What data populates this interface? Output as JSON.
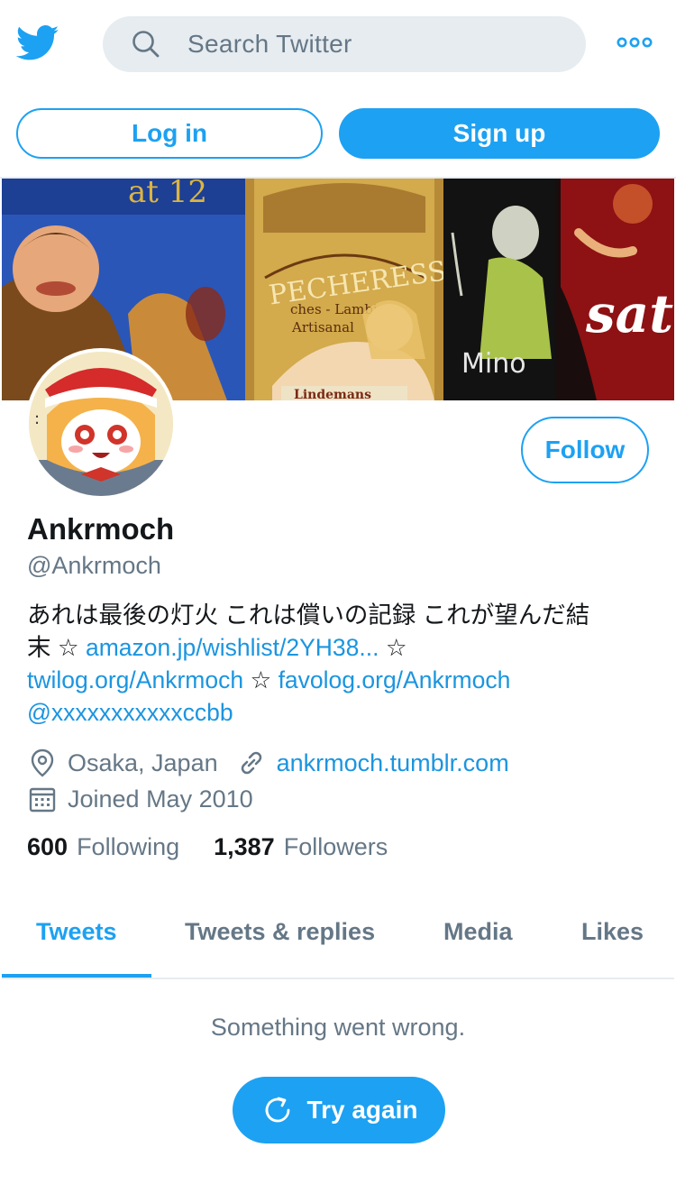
{
  "header": {
    "logo_icon": "twitter-bird-icon",
    "search_placeholder": "Search Twitter",
    "more_icon": "more-dots-icon"
  },
  "auth": {
    "login_label": "Log in",
    "signup_label": "Sign up"
  },
  "profile": {
    "follow_label": "Follow",
    "name": "Ankrmoch",
    "handle": "@Ankrmoch",
    "bio": {
      "line1": "あれは最後の灯火 これは償いの記録 これが望んだ結",
      "line2_prefix": "末 ☆ ",
      "link_amazon": "amazon.jp/wishlist/2YH38...",
      "line2_suffix": " ☆",
      "link_twilog": "twilog.org/Ankrmoch",
      "star": " ☆ ",
      "link_favolog": "favolog.org/Ankrmoch",
      "mention": "@xxxxxxxxxxxccbb"
    },
    "location": "Osaka, Japan",
    "website": "ankrmoch.tumblr.com",
    "joined": "Joined May 2010",
    "following_count": "600",
    "following_label": "Following",
    "followers_count": "1,387",
    "followers_label": "Followers"
  },
  "tabs": [
    {
      "label": "Tweets",
      "active": true
    },
    {
      "label": "Tweets & replies",
      "active": false
    },
    {
      "label": "Media",
      "active": false
    },
    {
      "label": "Likes",
      "active": false
    }
  ],
  "error": {
    "message": "Something went wrong.",
    "retry_label": "Try again"
  },
  "colors": {
    "accent": "#1da1f2",
    "link": "#1b95e0",
    "muted": "#657786",
    "text": "#14171a"
  }
}
